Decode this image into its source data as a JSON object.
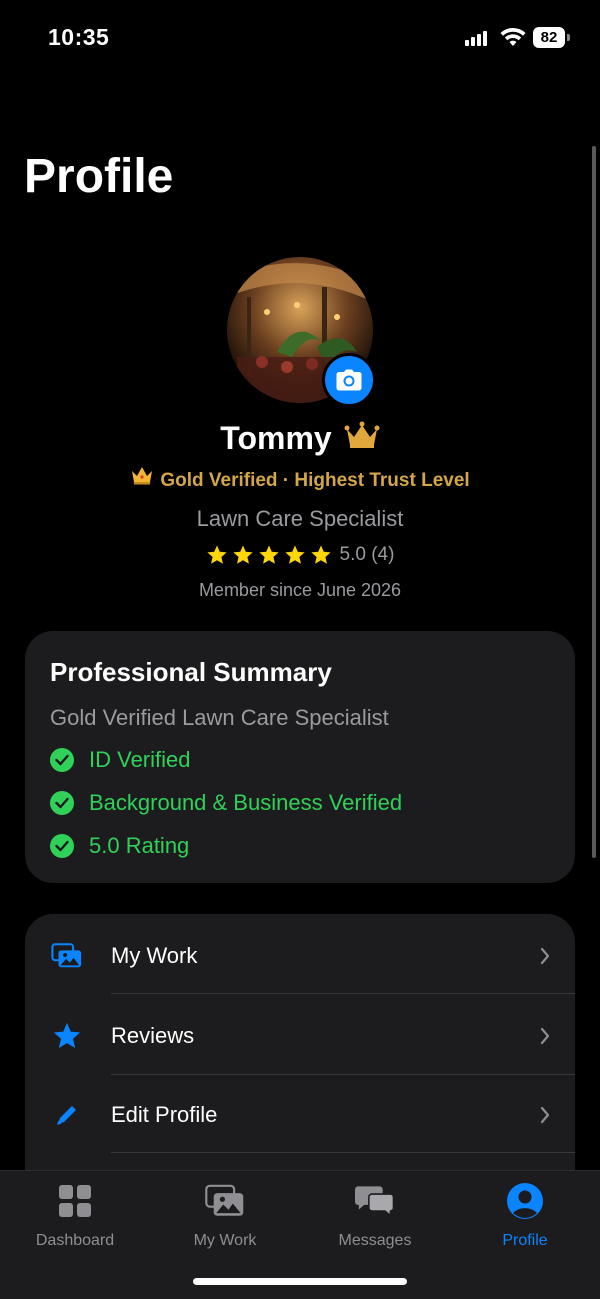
{
  "status_bar": {
    "time": "10:35",
    "battery": "82"
  },
  "page": {
    "title": "Profile"
  },
  "profile": {
    "name": "Tommy",
    "badge": "Gold Verified · Highest Trust Level",
    "job_title": "Lawn Care Specialist",
    "rating": 5.0,
    "rating_text": "5.0 (4)",
    "member_since": "Member since June 2026"
  },
  "summary": {
    "title": "Professional Summary",
    "subtitle": "Gold Verified Lawn Care Specialist",
    "checks": [
      "ID Verified",
      "Background & Business Verified",
      "5.0 Rating"
    ]
  },
  "menu": {
    "items": [
      {
        "label": "My Work",
        "icon": "photos-icon"
      },
      {
        "label": "Reviews",
        "icon": "star-icon"
      },
      {
        "label": "Edit Profile",
        "icon": "pencil-icon"
      }
    ]
  },
  "tabs": [
    {
      "label": "Dashboard",
      "icon": "grid-icon",
      "active": false
    },
    {
      "label": "My Work",
      "icon": "photos-icon",
      "active": false
    },
    {
      "label": "Messages",
      "icon": "chat-bubbles-icon",
      "active": false
    },
    {
      "label": "Profile",
      "icon": "person-circle-icon",
      "active": true
    }
  ],
  "colors": {
    "accent": "#0a84ff",
    "gold": "#d4a64a",
    "verified": "#30d158",
    "card": "#1c1c1e"
  }
}
